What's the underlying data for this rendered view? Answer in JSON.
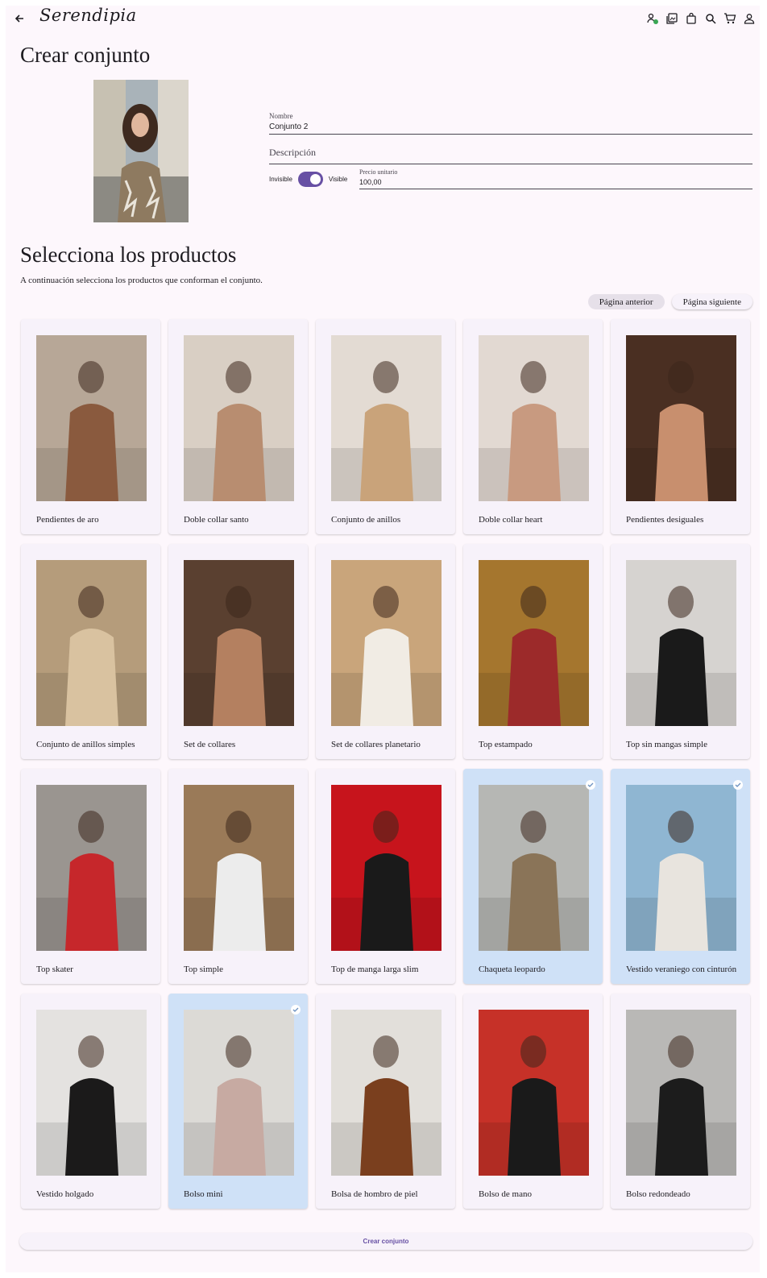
{
  "header": {
    "logo": "Serendipia",
    "icons": [
      "person-add-icon",
      "collections-icon",
      "shopping-bag-icon",
      "search-icon",
      "cart-icon",
      "account-icon"
    ]
  },
  "form": {
    "title": "Crear conjunto",
    "name_label": "Nombre",
    "name_value": "Conjunto 2",
    "description_placeholder": "Descripción",
    "invisible_label": "Invisible",
    "visible_label": "Visible",
    "visible_on": true,
    "price_label": "Precio unitario",
    "price_value": "100,00"
  },
  "products_section": {
    "title": "Selecciona los productos",
    "subtitle": "A continuación selecciona los productos que conforman el conjunto.",
    "prev_label": "Página anterior",
    "next_label": "Página siguiente"
  },
  "products": [
    {
      "name": "Pendientes de aro",
      "selected": false,
      "bg": "#b7a797",
      "fg": "#8a5a3e"
    },
    {
      "name": "Doble collar santo",
      "selected": false,
      "bg": "#d9cfc4",
      "fg": "#b88d70"
    },
    {
      "name": "Conjunto de anillos",
      "selected": false,
      "bg": "#e3dbd3",
      "fg": "#c9a37a"
    },
    {
      "name": "Doble collar heart",
      "selected": false,
      "bg": "#e2d9d2",
      "fg": "#c89a80"
    },
    {
      "name": "Pendientes desiguales",
      "selected": false,
      "bg": "#4a2f22",
      "fg": "#c88f6e"
    },
    {
      "name": "Conjunto de anillos simples",
      "selected": false,
      "bg": "#b59c7b",
      "fg": "#d9c2a0"
    },
    {
      "name": "Set de collares",
      "selected": false,
      "bg": "#5a4030",
      "fg": "#b48060"
    },
    {
      "name": "Set de collares planetario",
      "selected": false,
      "bg": "#c9a57b",
      "fg": "#f1ece4"
    },
    {
      "name": "Top estampado",
      "selected": false,
      "bg": "#a5762e",
      "fg": "#9c2a2a"
    },
    {
      "name": "Top sin mangas simple",
      "selected": false,
      "bg": "#d6d3d0",
      "fg": "#1a1a1a"
    },
    {
      "name": "Top skater",
      "selected": false,
      "bg": "#9a9590",
      "fg": "#c6272b"
    },
    {
      "name": "Top simple",
      "selected": false,
      "bg": "#9a7a58",
      "fg": "#ececec"
    },
    {
      "name": "Top de manga larga slim",
      "selected": false,
      "bg": "#c7141c",
      "fg": "#1a1a1a"
    },
    {
      "name": "Chaqueta leopardo",
      "selected": true,
      "bg": "#b6b7b4",
      "fg": "#8a7458"
    },
    {
      "name": "Vestido veraniego con cinturón",
      "selected": true,
      "bg": "#8fb6d2",
      "fg": "#e8e4de"
    },
    {
      "name": "Vestido holgado",
      "selected": false,
      "bg": "#e4e2e0",
      "fg": "#1b1a1a"
    },
    {
      "name": "Bolso mini",
      "selected": true,
      "bg": "#dcdad6",
      "fg": "#c7aaa2"
    },
    {
      "name": "Bolsa de hombro de piel",
      "selected": false,
      "bg": "#e2dfda",
      "fg": "#7a3f1e"
    },
    {
      "name": "Bolso de mano",
      "selected": false,
      "bg": "#c63128",
      "fg": "#1a1a1a"
    },
    {
      "name": "Bolso redondeado",
      "selected": false,
      "bg": "#b9b8b6",
      "fg": "#1c1c1c"
    }
  ],
  "footer": {
    "create_label": "Crear conjunto"
  }
}
